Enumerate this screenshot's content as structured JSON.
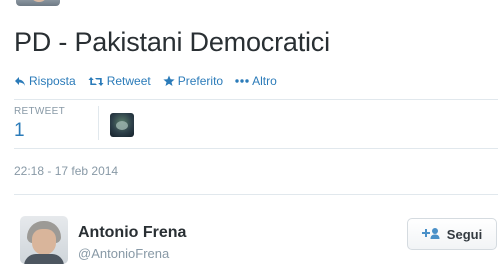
{
  "tweet": {
    "text": "PD - Pakistani Democratici",
    "timestamp": "22:18 - 17 feb 2014"
  },
  "actions": [
    {
      "icon": "reply-icon",
      "label": "Risposta"
    },
    {
      "icon": "retweet-icon",
      "label": "Retweet"
    },
    {
      "icon": "star-icon",
      "label": "Preferito"
    },
    {
      "icon": "more-dots-icon",
      "label": "Altro"
    }
  ],
  "stats": {
    "retweet_label": "RETWEET",
    "retweet_count": "1"
  },
  "author": {
    "name": "Antonio Frena",
    "handle": "@AntonioFrena"
  },
  "follow": {
    "label": "Segui",
    "icon": "add-user-icon"
  },
  "colors": {
    "link": "#2b7bb9",
    "muted": "#8899a6",
    "text": "#292f33",
    "divider": "#e1e8ed"
  }
}
